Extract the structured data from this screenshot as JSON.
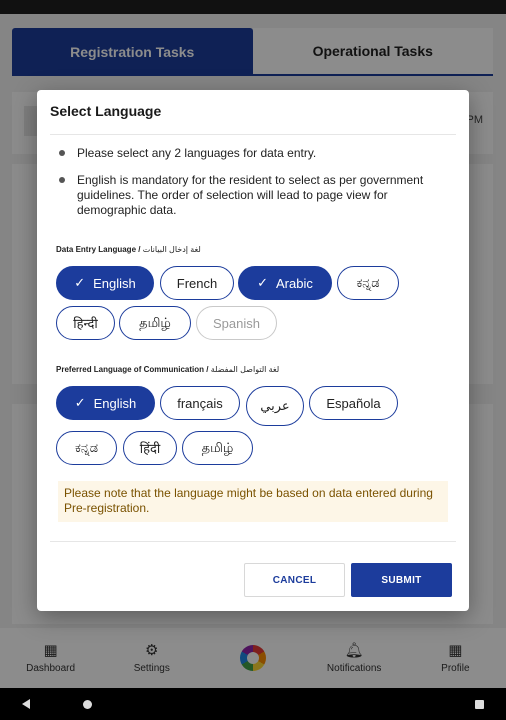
{
  "tabs": {
    "registration": "Registration Tasks",
    "operational": "Operational Tasks"
  },
  "background": {
    "time_fragment": "PM"
  },
  "bottom_nav": [
    {
      "label": "Dashboard",
      "icon": "grid-icon"
    },
    {
      "label": "Settings",
      "icon": "gear-icon"
    },
    {
      "label": "",
      "icon": "logo-icon"
    },
    {
      "label": "Notifications",
      "icon": "bell-icon"
    },
    {
      "label": "Profile",
      "icon": "grid-icon"
    }
  ],
  "dialog": {
    "title": "Select Language",
    "bullets": [
      "Please select any 2 languages for data entry.",
      "English is mandatory for the resident to select as per government guidelines. The order of selection will lead to page view for demographic data."
    ],
    "data_entry_label": "Data Entry Language / ",
    "data_entry_label_ar": "لغة إدخال البيانات",
    "data_entry_languages": [
      {
        "label": "English",
        "selected": true,
        "disabled": false
      },
      {
        "label": "French",
        "selected": false,
        "disabled": false
      },
      {
        "label": "Arabic",
        "selected": true,
        "disabled": false
      },
      {
        "label": "ಕನ್ನಡ",
        "selected": false,
        "disabled": false
      },
      {
        "label": "हिन्दी",
        "selected": false,
        "disabled": false
      },
      {
        "label": "தமிழ்",
        "selected": false,
        "disabled": false
      },
      {
        "label": "Spanish",
        "selected": false,
        "disabled": true
      }
    ],
    "preferred_label": "Preferred Language of Communication / ",
    "preferred_label_ar": "لغة التواصل المفضلة",
    "preferred_languages": [
      {
        "label": "English",
        "selected": true
      },
      {
        "label": "français",
        "selected": false
      },
      {
        "label": "عربي",
        "selected": false
      },
      {
        "label": "Española",
        "selected": false
      },
      {
        "label": "ಕನ್ನಡ",
        "selected": false
      },
      {
        "label": "हिंदी",
        "selected": false
      },
      {
        "label": "தமிழ்",
        "selected": false
      }
    ],
    "note": "Please note that the language might be based on data entered during Pre-registration.",
    "cancel_label": "CANCEL",
    "submit_label": "SUBMIT",
    "check_glyph": "✓"
  },
  "colors": {
    "primary": "#1c3c9c",
    "note_bg": "#fdf6e7",
    "note_text": "#7a5200"
  }
}
